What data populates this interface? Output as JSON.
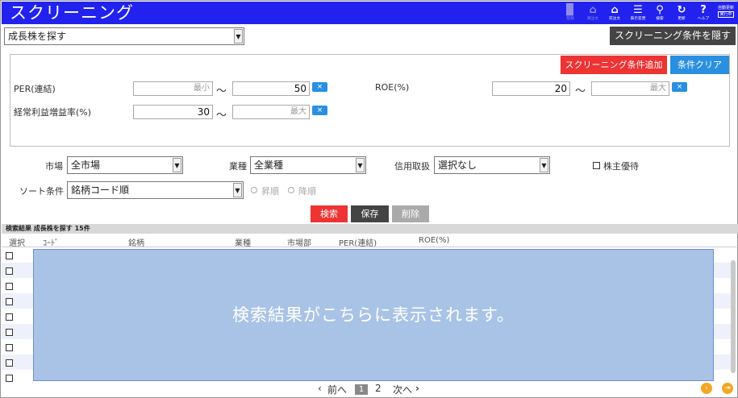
{
  "header": {
    "title": "スクリーニング",
    "icons": [
      {
        "name": "register-icon",
        "label": "登録"
      },
      {
        "name": "buy-order-icon",
        "label": "買注文"
      },
      {
        "name": "sell-order-icon",
        "label": "売注文"
      },
      {
        "name": "display-change-icon",
        "label": "表示変更"
      },
      {
        "name": "search-icon",
        "label": "検索"
      },
      {
        "name": "refresh-icon",
        "label": "更新"
      },
      {
        "name": "help-icon",
        "label": "ヘルプ"
      }
    ],
    "auto_update_label": "自動更新",
    "auto_update_state": "実行中"
  },
  "preset": {
    "selected": "成長株を探す"
  },
  "hide_conditions_button": "スクリーニング条件を隠す",
  "conditions": {
    "add_button": "スクリーニング条件追加",
    "clear_button": "条件クリア",
    "per": {
      "label": "PER(連結)",
      "min_placeholder": "最小",
      "max_value": "50"
    },
    "roe": {
      "label": "ROE(%)",
      "min_value": "20",
      "max_placeholder": "最大"
    },
    "profit_growth": {
      "label": "経常利益増益率(%)",
      "min_value": "30",
      "max_placeholder": "最大"
    },
    "range_separator": "～",
    "remove_symbol": "×"
  },
  "filters": {
    "market_label": "市場",
    "market_value": "全市場",
    "industry_label": "業種",
    "industry_value": "全業種",
    "credit_label": "信用取扱",
    "credit_value": "選択なし",
    "benefit_label": "株主優待",
    "sort_label": "ソート条件",
    "sort_value": "銘柄コード順",
    "asc_label": "昇順",
    "desc_label": "降順"
  },
  "actions": {
    "search": "検索",
    "save": "保存",
    "delete": "削除"
  },
  "results": {
    "header": "検索結果 成長株を探す 15件",
    "columns": [
      "選択",
      "ｺｰﾄﾞ",
      "銘柄",
      "業種",
      "市場部",
      "PER(連結)",
      "ROE(%)"
    ],
    "placeholder_message": "検索結果がこちらに表示されます。"
  },
  "pagination": {
    "prev": "前へ",
    "pages": [
      "1",
      "2"
    ],
    "next": "次へ"
  },
  "colors": {
    "header_bg": "#2222ee",
    "add_button": "#ee3333",
    "clear_button": "#2a8fe0",
    "search_button": "#ee3333",
    "save_button": "#444444",
    "delete_button": "#aaaaaa",
    "overlay": "#a9c3e6",
    "pager_circle": "#f5a623"
  }
}
